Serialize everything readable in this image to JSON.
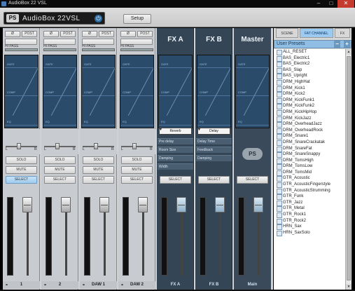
{
  "window": {
    "title": "AudioBox 22 VSL",
    "controls": [
      "–",
      "□",
      "✕"
    ]
  },
  "header": {
    "logo_mark": "PS",
    "device_name": "AudioBox 22VSL",
    "setup_label": "Setup"
  },
  "input_strips": [
    {
      "label": "1",
      "phase": "Ø",
      "post": "POST",
      "hipass": "HI PASS",
      "eq_tags": [
        "GATE",
        "COMP",
        "EQ"
      ],
      "solo": "SOLO",
      "mute": "MUTE",
      "select": "SELECT",
      "select_active": true,
      "pan_l": "L",
      "pan_r": "R"
    },
    {
      "label": "2",
      "phase": "Ø",
      "post": "POST",
      "hipass": "HI PASS",
      "eq_tags": [
        "GATE",
        "COMP",
        "EQ"
      ],
      "solo": "SOLO",
      "mute": "MUTE",
      "select": "SELECT",
      "select_active": false,
      "pan_l": "L",
      "pan_r": "R"
    },
    {
      "label": "DAW 1",
      "phase": "Ø",
      "post": "POST",
      "hipass": "HI PASS",
      "eq_tags": [
        "GATE",
        "COMP",
        "EQ"
      ],
      "solo": "SOLO",
      "mute": "MUTE",
      "select": "SELECT",
      "select_active": false,
      "pan_l": "L",
      "pan_r": "R"
    },
    {
      "label": "DAW 2",
      "phase": "Ø",
      "post": "POST",
      "hipass": "HI PASS",
      "eq_tags": [
        "GATE",
        "COMP",
        "EQ"
      ],
      "solo": "SOLO",
      "mute": "MUTE",
      "select": "SELECT",
      "select_active": false,
      "pan_l": "L",
      "pan_r": "R"
    }
  ],
  "fx_strips": [
    {
      "name": "FX A",
      "label": "FX A",
      "dropdown": "Reverb",
      "params": [
        "Pre delay",
        "Room Size",
        "Damping",
        "Width"
      ],
      "select": "SELECT",
      "eq_tags": [
        "GATE",
        "COMP",
        "EQ"
      ]
    },
    {
      "name": "FX B",
      "label": "FX B",
      "dropdown": "Delay",
      "params": [
        "Delay Time",
        "Feedback",
        "Damping"
      ],
      "select": "SELECT",
      "eq_tags": [
        "GATE",
        "COMP",
        "EQ"
      ]
    }
  ],
  "master": {
    "name": "Master",
    "label": "Main",
    "logo": "PS",
    "select": "SELECT",
    "eq_tags": [
      "GATE",
      "COMP",
      "EQ"
    ]
  },
  "right_panel": {
    "tabs": [
      {
        "label": "SCENE",
        "active": false
      },
      {
        "label": "FAT CHANNEL",
        "active": true
      },
      {
        "label": "FX",
        "active": false
      }
    ],
    "presets_header": "User Presets",
    "minus": "−",
    "plus": "+",
    "presets": [
      "ALL_RESET",
      "BAS_Electric1",
      "BAS_Electric2",
      "BAS_Slap",
      "BAS_Upright",
      "DRM_HighHat",
      "DRM_Kick1",
      "DRM_Kick2",
      "DRM_KickFunk1",
      "DRM_KickFunk2",
      "DRM_KickHipHop",
      "DRM_KickJazz",
      "DRM_OverheadJazz",
      "DRM_OverheadRock",
      "DRM_Snare1",
      "DRM_SnareCrackatak",
      "DRM_SnareFat",
      "DRM_SnareSnappy",
      "DRM_TomsHigh",
      "DRM_TomsLow",
      "DRM_TomsMid",
      "GTR_Acoustic",
      "GTR_AcousticFingerstyle",
      "GTR_AcousticStrumming",
      "GTR_Funk",
      "GTR_Jazz",
      "GTR_Metal",
      "GTR_Rock1",
      "GTR_Rock2",
      "HRN_Sax",
      "HRN_SaxSolo"
    ]
  },
  "colors": {
    "accent": "#9ccaf0",
    "fx_strip": "#344556",
    "eq_bg": "#2a4b6a",
    "close": "#c53b2e"
  }
}
